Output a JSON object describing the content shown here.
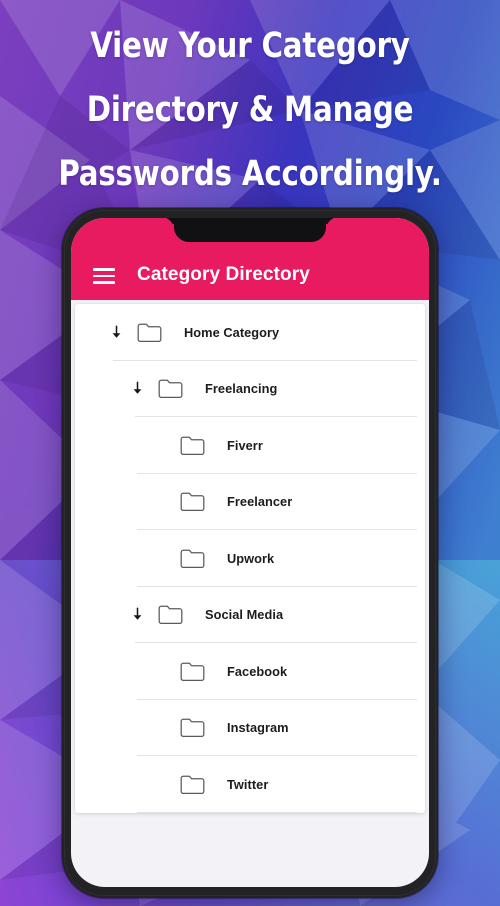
{
  "headline": {
    "lines": [
      "View Your Category",
      "Directory & Manage",
      "Passwords Accordingly."
    ]
  },
  "colors": {
    "appbar_pink": "#E81B60",
    "backdrop_purple": "#7B3FBF",
    "backdrop_blue": "#2A2FB0",
    "backdrop_cyan": "#4FB3D9",
    "phone_frame": "#232326",
    "card_white": "#FFFFFF",
    "divider": "#E3E3E6",
    "label_text": "#1C1C1E"
  },
  "phone": {
    "appbar": {
      "menu_icon": "hamburger-menu-icon",
      "title": "Category Directory"
    },
    "list": {
      "items": [
        {
          "label": "Home Category",
          "depth": 0,
          "expandable": true,
          "icon": "folder-icon",
          "arrow": "arrow-down-icon"
        },
        {
          "label": "Freelancing",
          "depth": 1,
          "expandable": true,
          "icon": "folder-icon",
          "arrow": "arrow-down-icon"
        },
        {
          "label": "Fiverr",
          "depth": 2,
          "expandable": false,
          "icon": "folder-icon",
          "arrow": ""
        },
        {
          "label": "Freelancer",
          "depth": 2,
          "expandable": false,
          "icon": "folder-icon",
          "arrow": ""
        },
        {
          "label": "Upwork",
          "depth": 2,
          "expandable": false,
          "icon": "folder-icon",
          "arrow": ""
        },
        {
          "label": "Social Media",
          "depth": 1,
          "expandable": true,
          "icon": "folder-icon",
          "arrow": "arrow-down-icon"
        },
        {
          "label": "Facebook",
          "depth": 2,
          "expandable": false,
          "icon": "folder-icon",
          "arrow": ""
        },
        {
          "label": "Instagram",
          "depth": 2,
          "expandable": false,
          "icon": "folder-icon",
          "arrow": ""
        },
        {
          "label": "Twitter",
          "depth": 2,
          "expandable": false,
          "icon": "folder-icon",
          "arrow": ""
        }
      ]
    }
  }
}
